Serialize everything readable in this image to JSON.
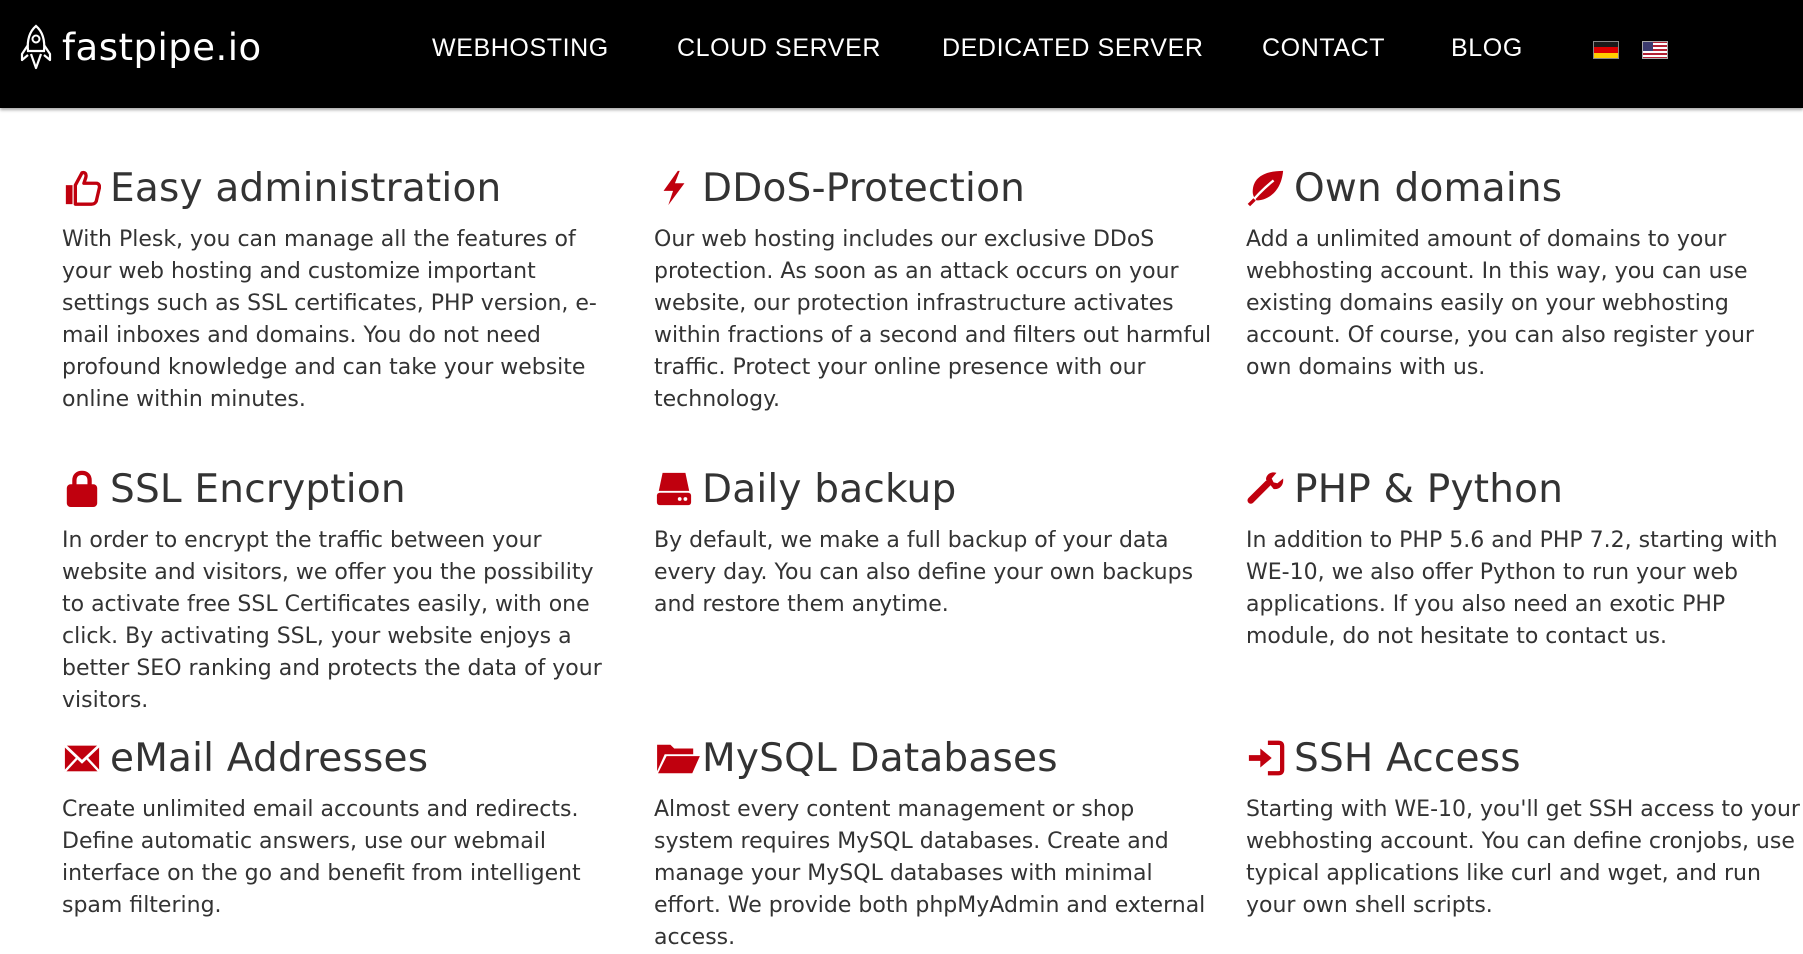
{
  "logo": {
    "text": "fastpipe.io",
    "icon": "rocket-icon"
  },
  "nav": [
    {
      "label": "WEBHOSTING"
    },
    {
      "label": "CLOUD SERVER"
    },
    {
      "label": "DEDICATED SERVER"
    },
    {
      "label": "CONTACT"
    },
    {
      "label": "BLOG"
    }
  ],
  "languages": [
    {
      "icon": "german-flag-icon"
    },
    {
      "icon": "us-flag-icon"
    }
  ],
  "accent_color": "#c0000e",
  "features": [
    {
      "icon": "thumbs-up-icon",
      "title": "Easy administration",
      "text": "With Plesk, you can manage all the features of your web hosting and customize important settings such as SSL certificates, PHP version, e-mail inboxes and domains. You do not need profound knowledge and can take your website online within minutes."
    },
    {
      "icon": "bolt-icon",
      "title": "DDoS-Protection",
      "text": "Our web hosting includes our exclusive DDoS protection. As soon as an attack occurs on your website, our protection infrastructure activates within fractions of a second and filters out harmful traffic. Protect your online presence with our technology."
    },
    {
      "icon": "leaf-icon",
      "title": "Own domains",
      "text": "Add a unlimited amount of domains to your webhosting account. In this way, you can use existing domains easily on your webhosting account. Of course, you can also register your own domains with us."
    },
    {
      "icon": "lock-icon",
      "title": "SSL Encryption",
      "text": "In order to encrypt the traffic between your website and visitors, we offer you the possibility to activate free SSL Certificates easily, with one click. By activating SSL, your website enjoys a better SEO ranking and protects the data of your visitors."
    },
    {
      "icon": "hard-drive-icon",
      "title": "Daily backup",
      "text": "By default, we make a full backup of your data every day. You can also define your own backups and restore them anytime."
    },
    {
      "icon": "wrench-icon",
      "title": "PHP & Python",
      "text": "In addition to PHP 5.6 and PHP 7.2, starting with WE-10, we also offer Python to run your web applications. If you also need an exotic PHP module, do not hesitate to contact us."
    },
    {
      "icon": "envelope-icon",
      "title": "eMail Addresses",
      "text": "Create unlimited email accounts and redirects. Define automatic answers, use our webmail interface on the go and benefit from intelligent spam filtering."
    },
    {
      "icon": "folder-open-icon",
      "title": "MySQL Databases",
      "text": "Almost every content management or shop system requires MySQL databases. Create and manage your MySQL databases with minimal effort. We provide both phpMyAdmin and external access."
    },
    {
      "icon": "sign-in-icon",
      "title": "SSH Access",
      "text": "Starting with WE-10, you'll get SSH access to your webhosting account. You can define cronjobs, use typical applications like curl and wget, and run your own shell scripts."
    }
  ]
}
